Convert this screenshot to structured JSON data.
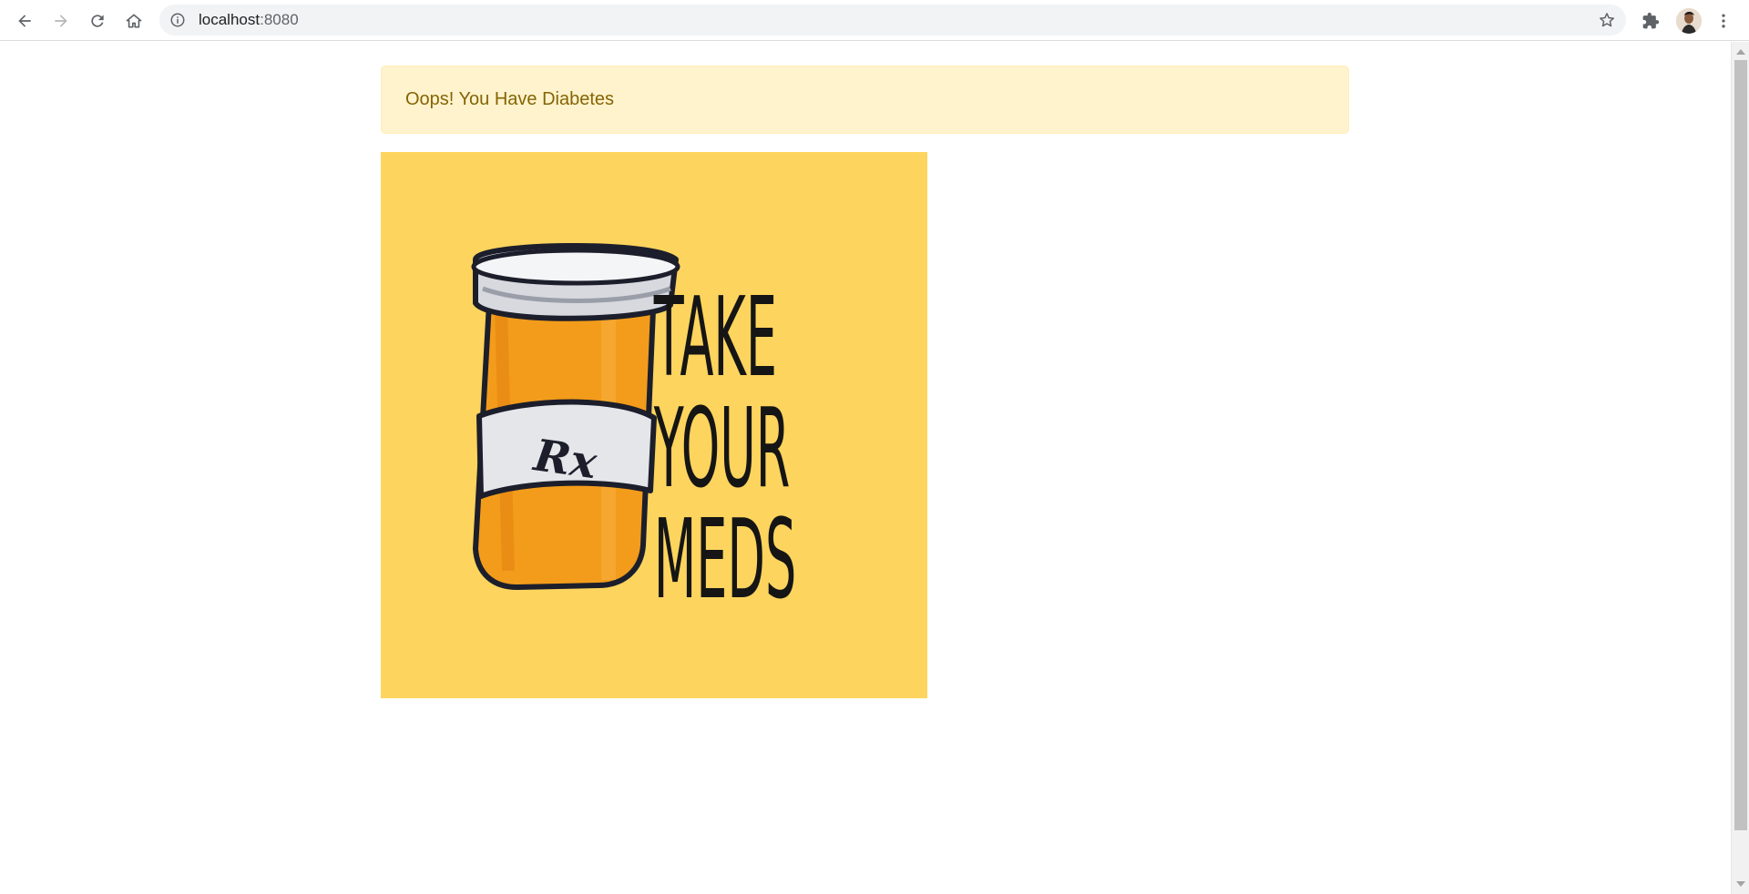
{
  "browser": {
    "url_host": "localhost",
    "url_port": ":8080",
    "icons": [
      "back-arrow-icon",
      "forward-arrow-icon",
      "reload-icon",
      "home-icon",
      "info-icon",
      "star-icon",
      "extensions-puzzle-icon",
      "profile-avatar",
      "menu-dots-icon"
    ]
  },
  "page": {
    "alert_text": "Oops! You Have Diabetes",
    "alert_bg": "#fff3cd",
    "alert_color": "#856404",
    "poster": {
      "background": "#fdd45d",
      "label_text": "Rx",
      "words": [
        "TAKE",
        "YOUR",
        "MEDS"
      ]
    }
  }
}
